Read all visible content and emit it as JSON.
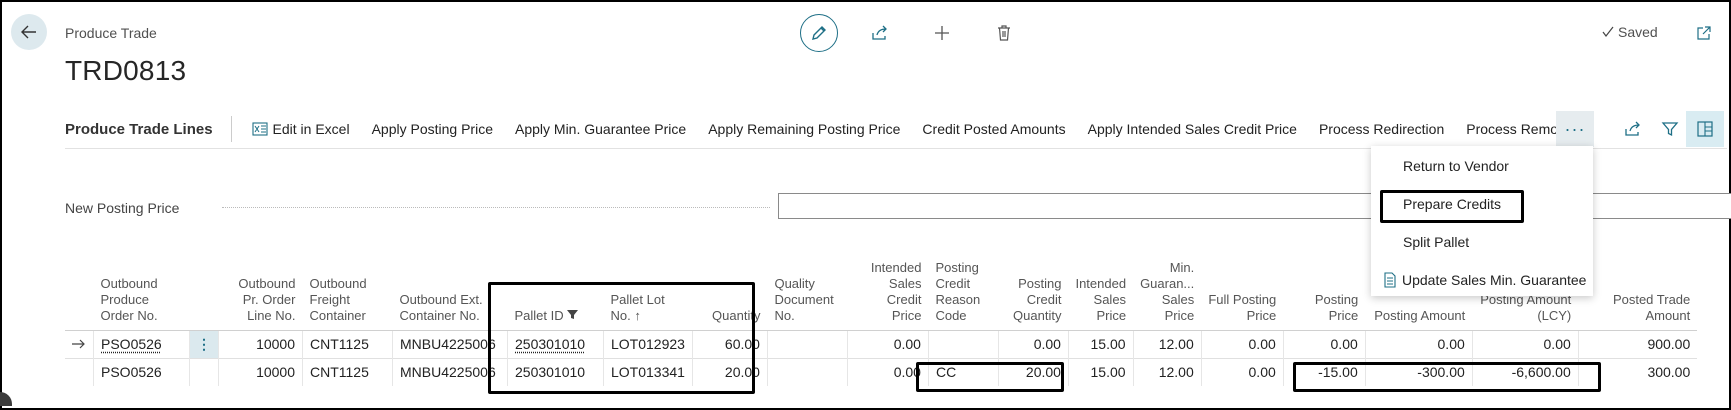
{
  "header": {
    "breadcrumb": "Produce Trade",
    "title": "TRD0813",
    "saved_label": "Saved"
  },
  "toolbar": {
    "section_title": "Produce Trade Lines",
    "actions": [
      "Edit in Excel",
      "Apply Posting Price",
      "Apply Min. Guarantee Price",
      "Apply Remaining Posting Price",
      "Credit Posted Amounts",
      "Apply Intended Sales Credit Price",
      "Process Redirection",
      "Process Removal"
    ],
    "more_label": "···"
  },
  "more_menu": {
    "items": [
      "Return to Vendor",
      "Prepare Credits",
      "Split Pallet",
      "Update Sales Min. Guarantee"
    ]
  },
  "new_posting_price": {
    "label": "New Posting Price",
    "value": ""
  },
  "grid": {
    "columns": [
      "Outbound Produce Order No.",
      "Outbound Pr. Order Line No.",
      "Outbound Freight Container",
      "Outbound Ext. Container No.",
      "Pallet ID",
      "Pallet Lot No.",
      "Quantity",
      "Quality Document No.",
      "Intended Sales Credit Price",
      "Posting Credit Reason Code",
      "Posting Credit Quantity",
      "Intended Sales Price",
      "Min. Guaran... Sales Price",
      "Full Posting Price",
      "Posting Price",
      "Posting Amount",
      "Posting Amount (LCY)",
      "Posted Trade Amount"
    ],
    "rows": [
      [
        "PSO0526",
        "10000",
        "CNT1125",
        "MNBU4225006",
        "250301010",
        "LOT012923",
        "60.00",
        "",
        "0.00",
        "",
        "0.00",
        "15.00",
        "12.00",
        "0.00",
        "0.00",
        "0.00",
        "0.00",
        "900.00"
      ],
      [
        "PSO0526",
        "10000",
        "CNT1125",
        "MNBU4225006",
        "250301010",
        "LOT013341",
        "20.00",
        "",
        "0.00",
        "CC",
        "20.00",
        "15.00",
        "12.00",
        "0.00",
        "-15.00",
        "-300.00",
        "-6,600.00",
        "300.00"
      ]
    ],
    "row_menu_label": "⋮",
    "pallet_id_sort": "filtered",
    "pallet_lot_sort": "ascending"
  },
  "colors": {
    "accent": "#1e6f86",
    "link": "#1e6f86",
    "highlight_border": "#000000"
  }
}
